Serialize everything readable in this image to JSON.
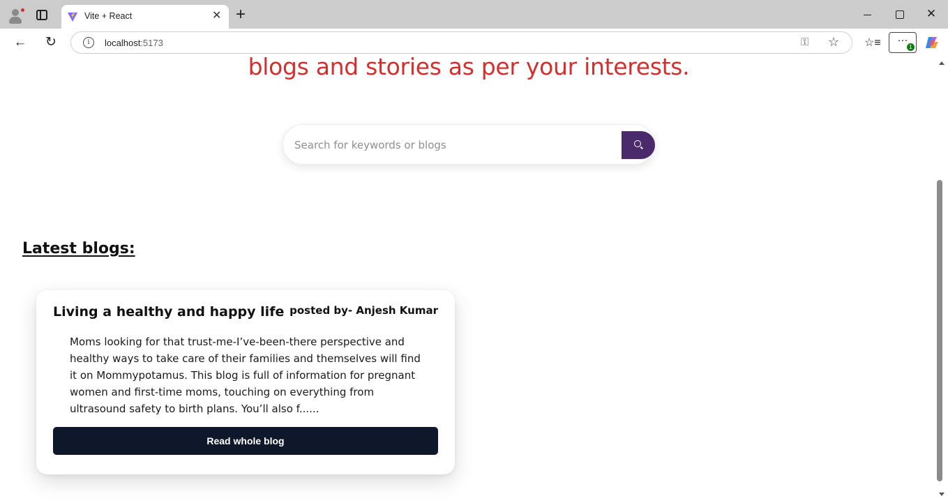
{
  "browser": {
    "tab_title": "Vite + React",
    "url_host": "localhost",
    "url_port": ":5173",
    "notification_count": "1",
    "icons": {
      "profile": "profile-icon",
      "tabs": "tab-actions-icon",
      "favicon": "vite-icon",
      "close_tab": "close-icon",
      "new_tab": "plus-icon",
      "back": "back-arrow-icon",
      "reload": "reload-icon",
      "site_info": "info-icon",
      "password": "key-icon",
      "favorite": "star-icon",
      "favorites": "favorites-icon",
      "more": "more-icon",
      "copilot": "copilot-icon"
    }
  },
  "hero": {
    "tagline_line": "blogs and stories as per your interests."
  },
  "search": {
    "placeholder": "Search for keywords or blogs",
    "value": "",
    "button_icon": "search-icon"
  },
  "latest": {
    "heading": "Latest blogs:"
  },
  "blogs": [
    {
      "title": "Living a healthy and happy life",
      "author": "posted by- Anjesh Kumar",
      "excerpt": "Moms looking for that trust-me-I’ve-been-there perspective and healthy ways to take care of their families and themselves will find it on Mommypotamus. This blog is full of information for pregnant women and first-time moms, touching on everything from ultrasound safety to birth plans. You’ll also f......",
      "button_label": "Read whole blog"
    }
  ],
  "colors": {
    "accent_red": "#d32f2f",
    "search_button": "#4b2a6b",
    "card_button": "#0f172a"
  }
}
